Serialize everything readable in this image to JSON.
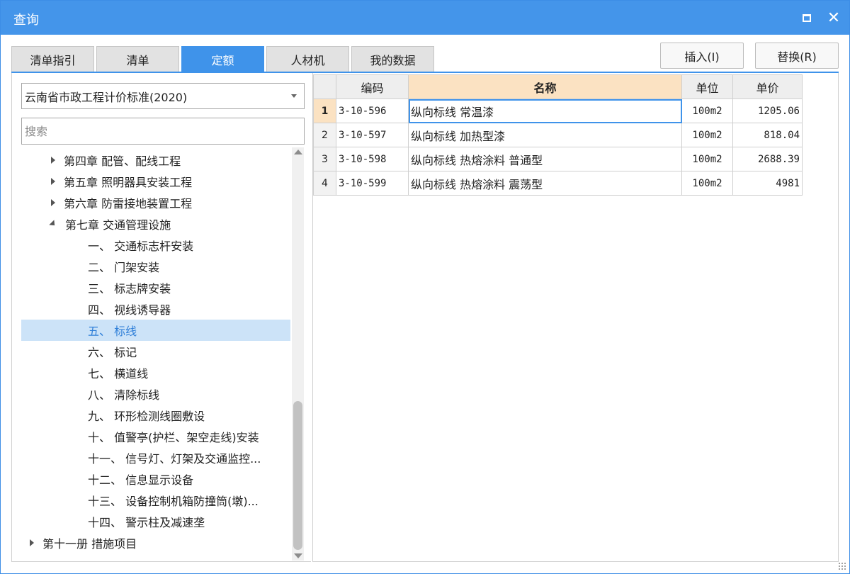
{
  "window": {
    "title": "查询"
  },
  "tabs": [
    {
      "label": "清单指引"
    },
    {
      "label": "清单"
    },
    {
      "label": "定额"
    },
    {
      "label": "人材机"
    },
    {
      "label": "我的数据"
    }
  ],
  "active_tab": "定额",
  "actions": {
    "insert_label": "插入(I)",
    "replace_label": "替换(R)"
  },
  "left": {
    "standard_select": "云南省市政工程计价标准(2020)",
    "search_placeholder": "搜索",
    "tree": [
      {
        "label": "第四章 配管、配线工程",
        "state": "collapsed"
      },
      {
        "label": "第五章 照明器具安装工程",
        "state": "collapsed"
      },
      {
        "label": "第六章 防雷接地装置工程",
        "state": "collapsed"
      },
      {
        "label": "第七章 交通管理设施",
        "state": "expanded"
      },
      {
        "label": "一、 交通标志杆安装"
      },
      {
        "label": "二、 门架安装"
      },
      {
        "label": "三、 标志牌安装"
      },
      {
        "label": "四、 视线诱导器"
      },
      {
        "label": "五、 标线",
        "selected": true
      },
      {
        "label": "六、 标记"
      },
      {
        "label": "七、 横道线"
      },
      {
        "label": "八、 清除标线"
      },
      {
        "label": "九、 环形检测线圈敷设"
      },
      {
        "label": "十、 值警亭(护栏、架空走线)安装"
      },
      {
        "label": "十一、 信号灯、灯架及交通监控..."
      },
      {
        "label": "十二、 信息显示设备"
      },
      {
        "label": "十三、 设备控制机箱防撞筒(墩)..."
      },
      {
        "label": "十四、 警示柱及减速垄"
      },
      {
        "label": "第十一册 措施项目",
        "state": "collapsed"
      }
    ]
  },
  "grid": {
    "headers": {
      "code": "编码",
      "name": "名称",
      "unit": "单位",
      "price": "单价"
    },
    "rows": [
      {
        "no": "1",
        "code": "3-10-596",
        "name": "纵向标线 常温漆",
        "unit": "100m2",
        "price": "1205.06"
      },
      {
        "no": "2",
        "code": "3-10-597",
        "name": "纵向标线 加热型漆",
        "unit": "100m2",
        "price": "818.04"
      },
      {
        "no": "3",
        "code": "3-10-598",
        "name": "纵向标线 热熔涂料 普通型",
        "unit": "100m2",
        "price": "2688.39"
      },
      {
        "no": "4",
        "code": "3-10-599",
        "name": "纵向标线 热熔涂料 震荡型",
        "unit": "100m2",
        "price": "4981"
      }
    ]
  },
  "colors": {
    "accent": "#4495ea",
    "sorted_header": "#fbe2c2",
    "selection": "#cce3f8"
  }
}
